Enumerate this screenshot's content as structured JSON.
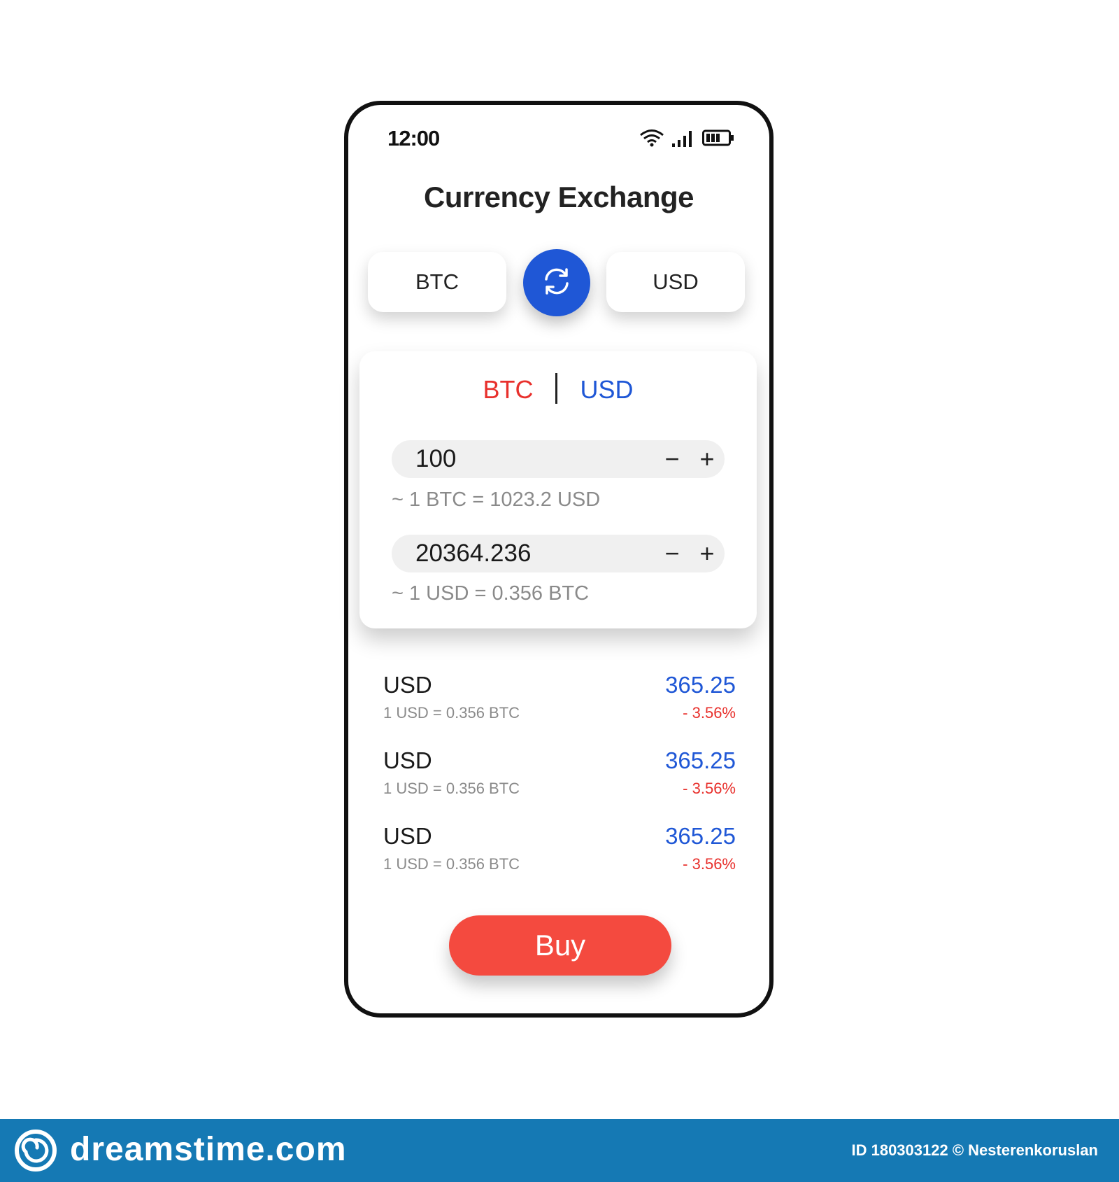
{
  "status": {
    "time": "12:00"
  },
  "title": "Currency Exchange",
  "selector": {
    "from": "BTC",
    "to": "USD"
  },
  "converter": {
    "pair_from": "BTC",
    "pair_to": "USD",
    "amount_from": "100",
    "rate_from": "~ 1 BTC = 1023.2 USD",
    "amount_to": "20364.236",
    "rate_to": "~ 1 USD = 0.356 BTC",
    "minus": "−",
    "plus": "+"
  },
  "rates": [
    {
      "currency": "USD",
      "rate": "1 USD = 0.356 BTC",
      "price": "365.25",
      "change": "- 3.56%"
    },
    {
      "currency": "USD",
      "rate": "1 USD = 0.356 BTC",
      "price": "365.25",
      "change": "- 3.56%"
    },
    {
      "currency": "USD",
      "rate": "1 USD = 0.356 BTC",
      "price": "365.25",
      "change": "- 3.56%"
    }
  ],
  "buy_label": "Buy",
  "footer": {
    "brand": "dreamstime.com",
    "credit": "ID 180303122 © Nesterenkoruslan"
  },
  "colors": {
    "accent_blue": "#1f57d6",
    "accent_red": "#f44a3f",
    "negative": "#e8302c",
    "footer_bg": "#1579b4"
  }
}
